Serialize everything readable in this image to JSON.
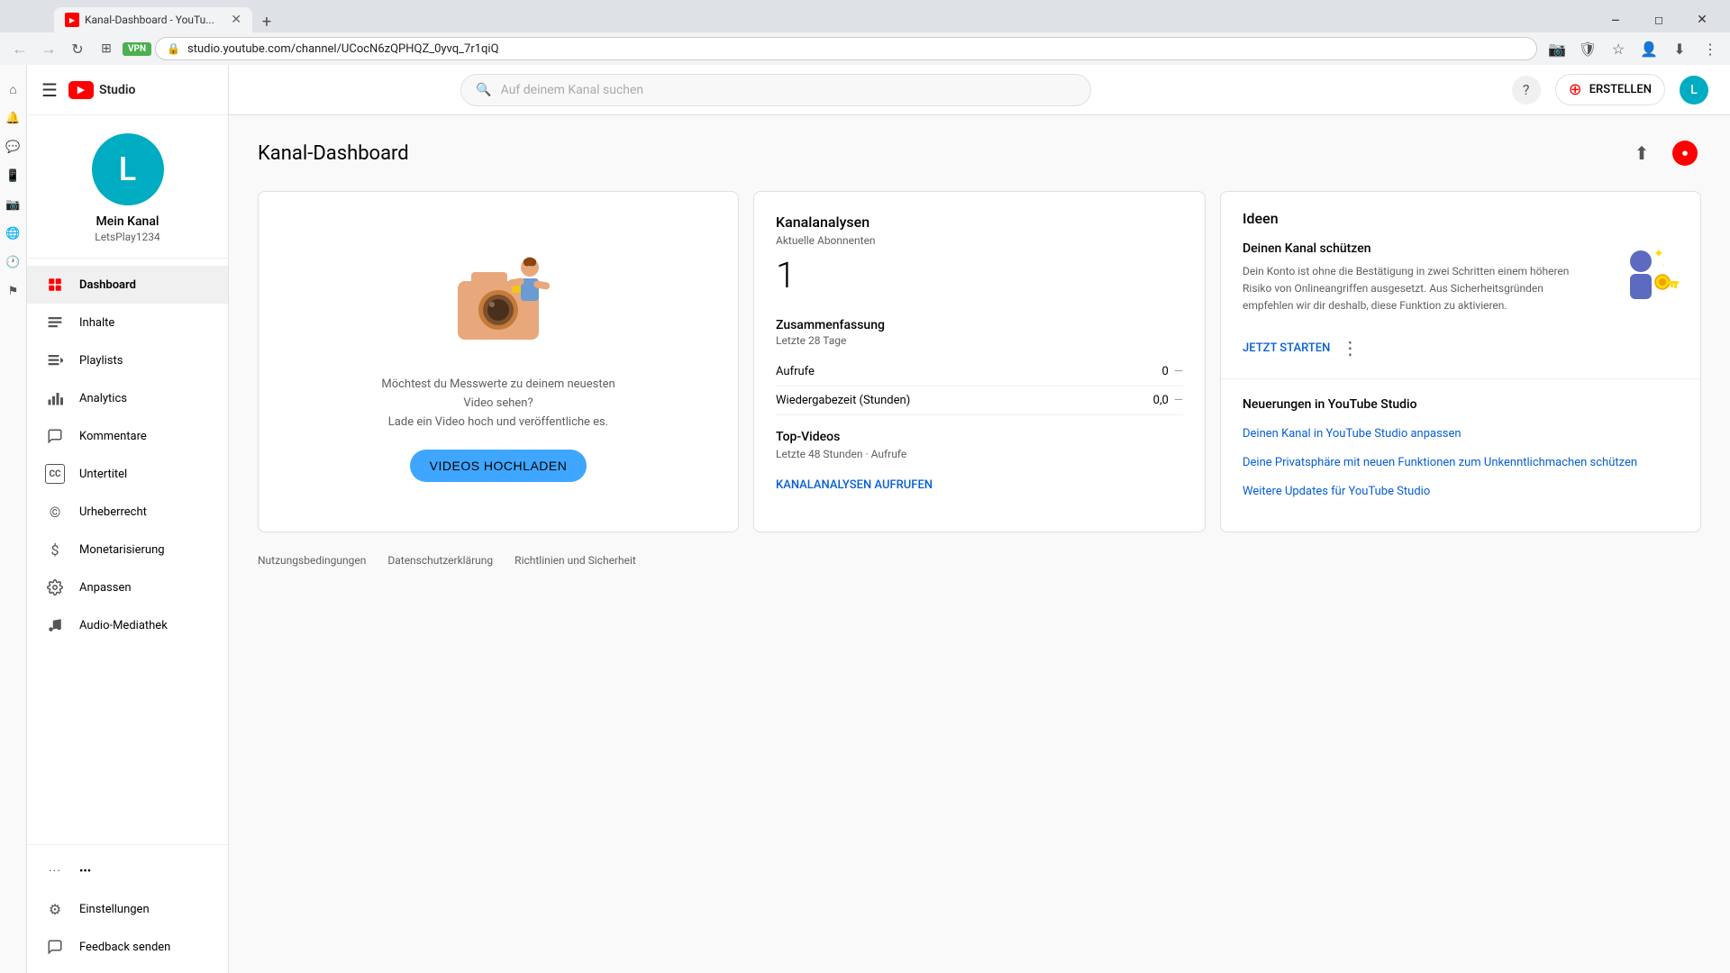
{
  "browser": {
    "tab_title": "Kanal-Dashboard - YouTu...",
    "tab_favicon": "YT",
    "address": "studio.youtube.com/channel/UCocN6zQPHQZ_0yvq_7r1qiQ",
    "vpn_label": "VPN"
  },
  "topbar": {
    "search_placeholder": "Auf deinem Kanal suchen",
    "create_label": "ERSTELLEN",
    "help_icon": "?",
    "user_initial": "L"
  },
  "sidebar": {
    "hamburger": "☰",
    "logo_text": "Studio",
    "channel_name": "Mein Kanal",
    "channel_handle": "LetsPlay1234",
    "avatar_initial": "L",
    "nav_items": [
      {
        "id": "dashboard",
        "label": "Dashboard",
        "active": true
      },
      {
        "id": "inhalte",
        "label": "Inhalte",
        "active": false
      },
      {
        "id": "playlists",
        "label": "Playlists",
        "active": false
      },
      {
        "id": "analytics",
        "label": "Analytics",
        "active": false
      },
      {
        "id": "kommentare",
        "label": "Kommentare",
        "active": false
      },
      {
        "id": "untertitel",
        "label": "Untertitel",
        "active": false
      },
      {
        "id": "urheberrecht",
        "label": "Urheberrecht",
        "active": false
      },
      {
        "id": "monetarisierung",
        "label": "Monetarisierung",
        "active": false
      },
      {
        "id": "anpassen",
        "label": "Anpassen",
        "active": false
      },
      {
        "id": "audio-mediathek",
        "label": "Audio-Mediathek",
        "active": false
      }
    ],
    "bottom_items": [
      {
        "id": "einstellungen",
        "label": "Einstellungen"
      },
      {
        "id": "feedback",
        "label": "Feedback senden"
      }
    ],
    "more_label": "•••"
  },
  "page": {
    "title": "Kanal-Dashboard"
  },
  "upload_card": {
    "text_line1": "Möchtest du Messwerte zu deinem neuesten Video sehen?",
    "text_line2": "Lade ein Video hoch und veröffentliche es.",
    "button_label": "VIDEOS HOCHLADEN"
  },
  "analytics_card": {
    "title": "Kanalanalysen",
    "subscribers_label": "Aktuelle Abonnenten",
    "subscribers_count": "1",
    "summary_title": "Zusammenfassung",
    "summary_period": "Letzte 28 Tage",
    "stats": [
      {
        "label": "Aufrufe",
        "value": "0",
        "dash": "—"
      },
      {
        "label": "Wiedergabezeit (Stunden)",
        "value": "0,0",
        "dash": "—"
      }
    ],
    "top_videos_title": "Top-Videos",
    "top_videos_subtitle": "Letzte 48 Stunden · Aufrufe",
    "cta_link": "KANALANALYSEN AUFRUFEN"
  },
  "ideas_card": {
    "title": "Ideen",
    "security_title": "Deinen Kanal schützen",
    "security_text": "Dein Konto ist ohne die Bestätigung in zwei Schritten einem höheren Risiko von Onlineangriffen ausgesetzt. Aus Sicherheitsgründen empfehlen wir dir deshalb, diese Funktion zu aktivieren.",
    "cta_label": "JETZT STARTEN",
    "updates_title": "Neuerungen in YouTube Studio",
    "update_items": [
      "Deinen Kanal in YouTube Studio anpassen",
      "Deine Privatsphäre mit neuen Funktionen zum Unkenntlichmachen schützen",
      "Weitere Updates für YouTube Studio"
    ]
  },
  "footer": {
    "links": [
      "Nutzungsbedingungen",
      "Datenschutzerklärung",
      "Richtlinien und Sicherheit"
    ]
  }
}
